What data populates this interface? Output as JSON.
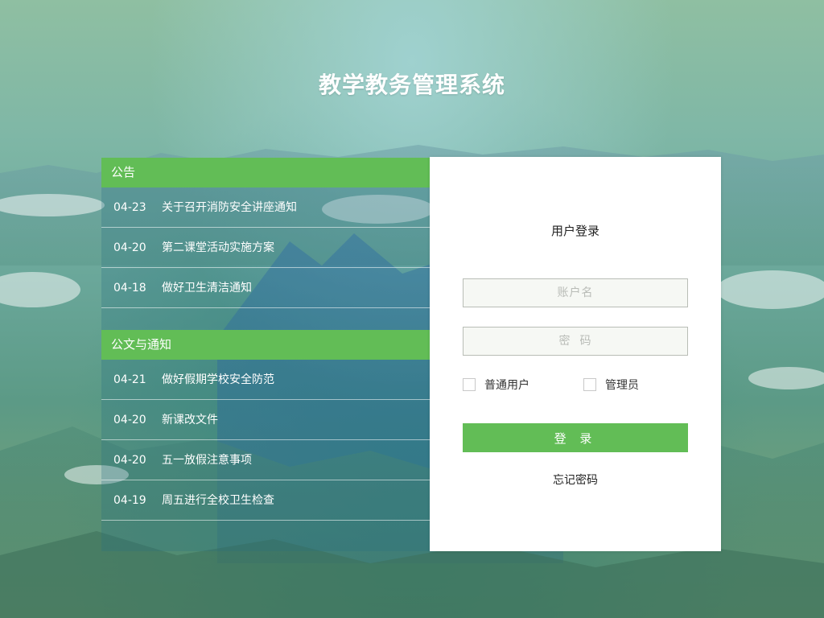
{
  "app": {
    "title": "教学教务管理系统"
  },
  "announcements": {
    "header": "公告",
    "items": [
      {
        "date": "04-23",
        "text": "关于召开消防安全讲座通知"
      },
      {
        "date": "04-20",
        "text": "第二课堂活动实施方案"
      },
      {
        "date": "04-18",
        "text": "做好卫生清洁通知"
      }
    ]
  },
  "documents": {
    "header": "公文与通知",
    "items": [
      {
        "date": "04-21",
        "text": "做好假期学校安全防范"
      },
      {
        "date": "04-20",
        "text": "新课改文件"
      },
      {
        "date": "04-20",
        "text": "五一放假注意事项"
      },
      {
        "date": "04-19",
        "text": "周五进行全校卫生检查"
      }
    ]
  },
  "login": {
    "title": "用户登录",
    "username_placeholder": "账户名",
    "password_placeholder": "密  码",
    "role_user_label": "普通用户",
    "role_admin_label": "管理员",
    "submit_label": "登 录",
    "forgot_label": "忘记密码"
  },
  "colors": {
    "accent": "#62bd56",
    "panel_bg": "#ffffff"
  }
}
